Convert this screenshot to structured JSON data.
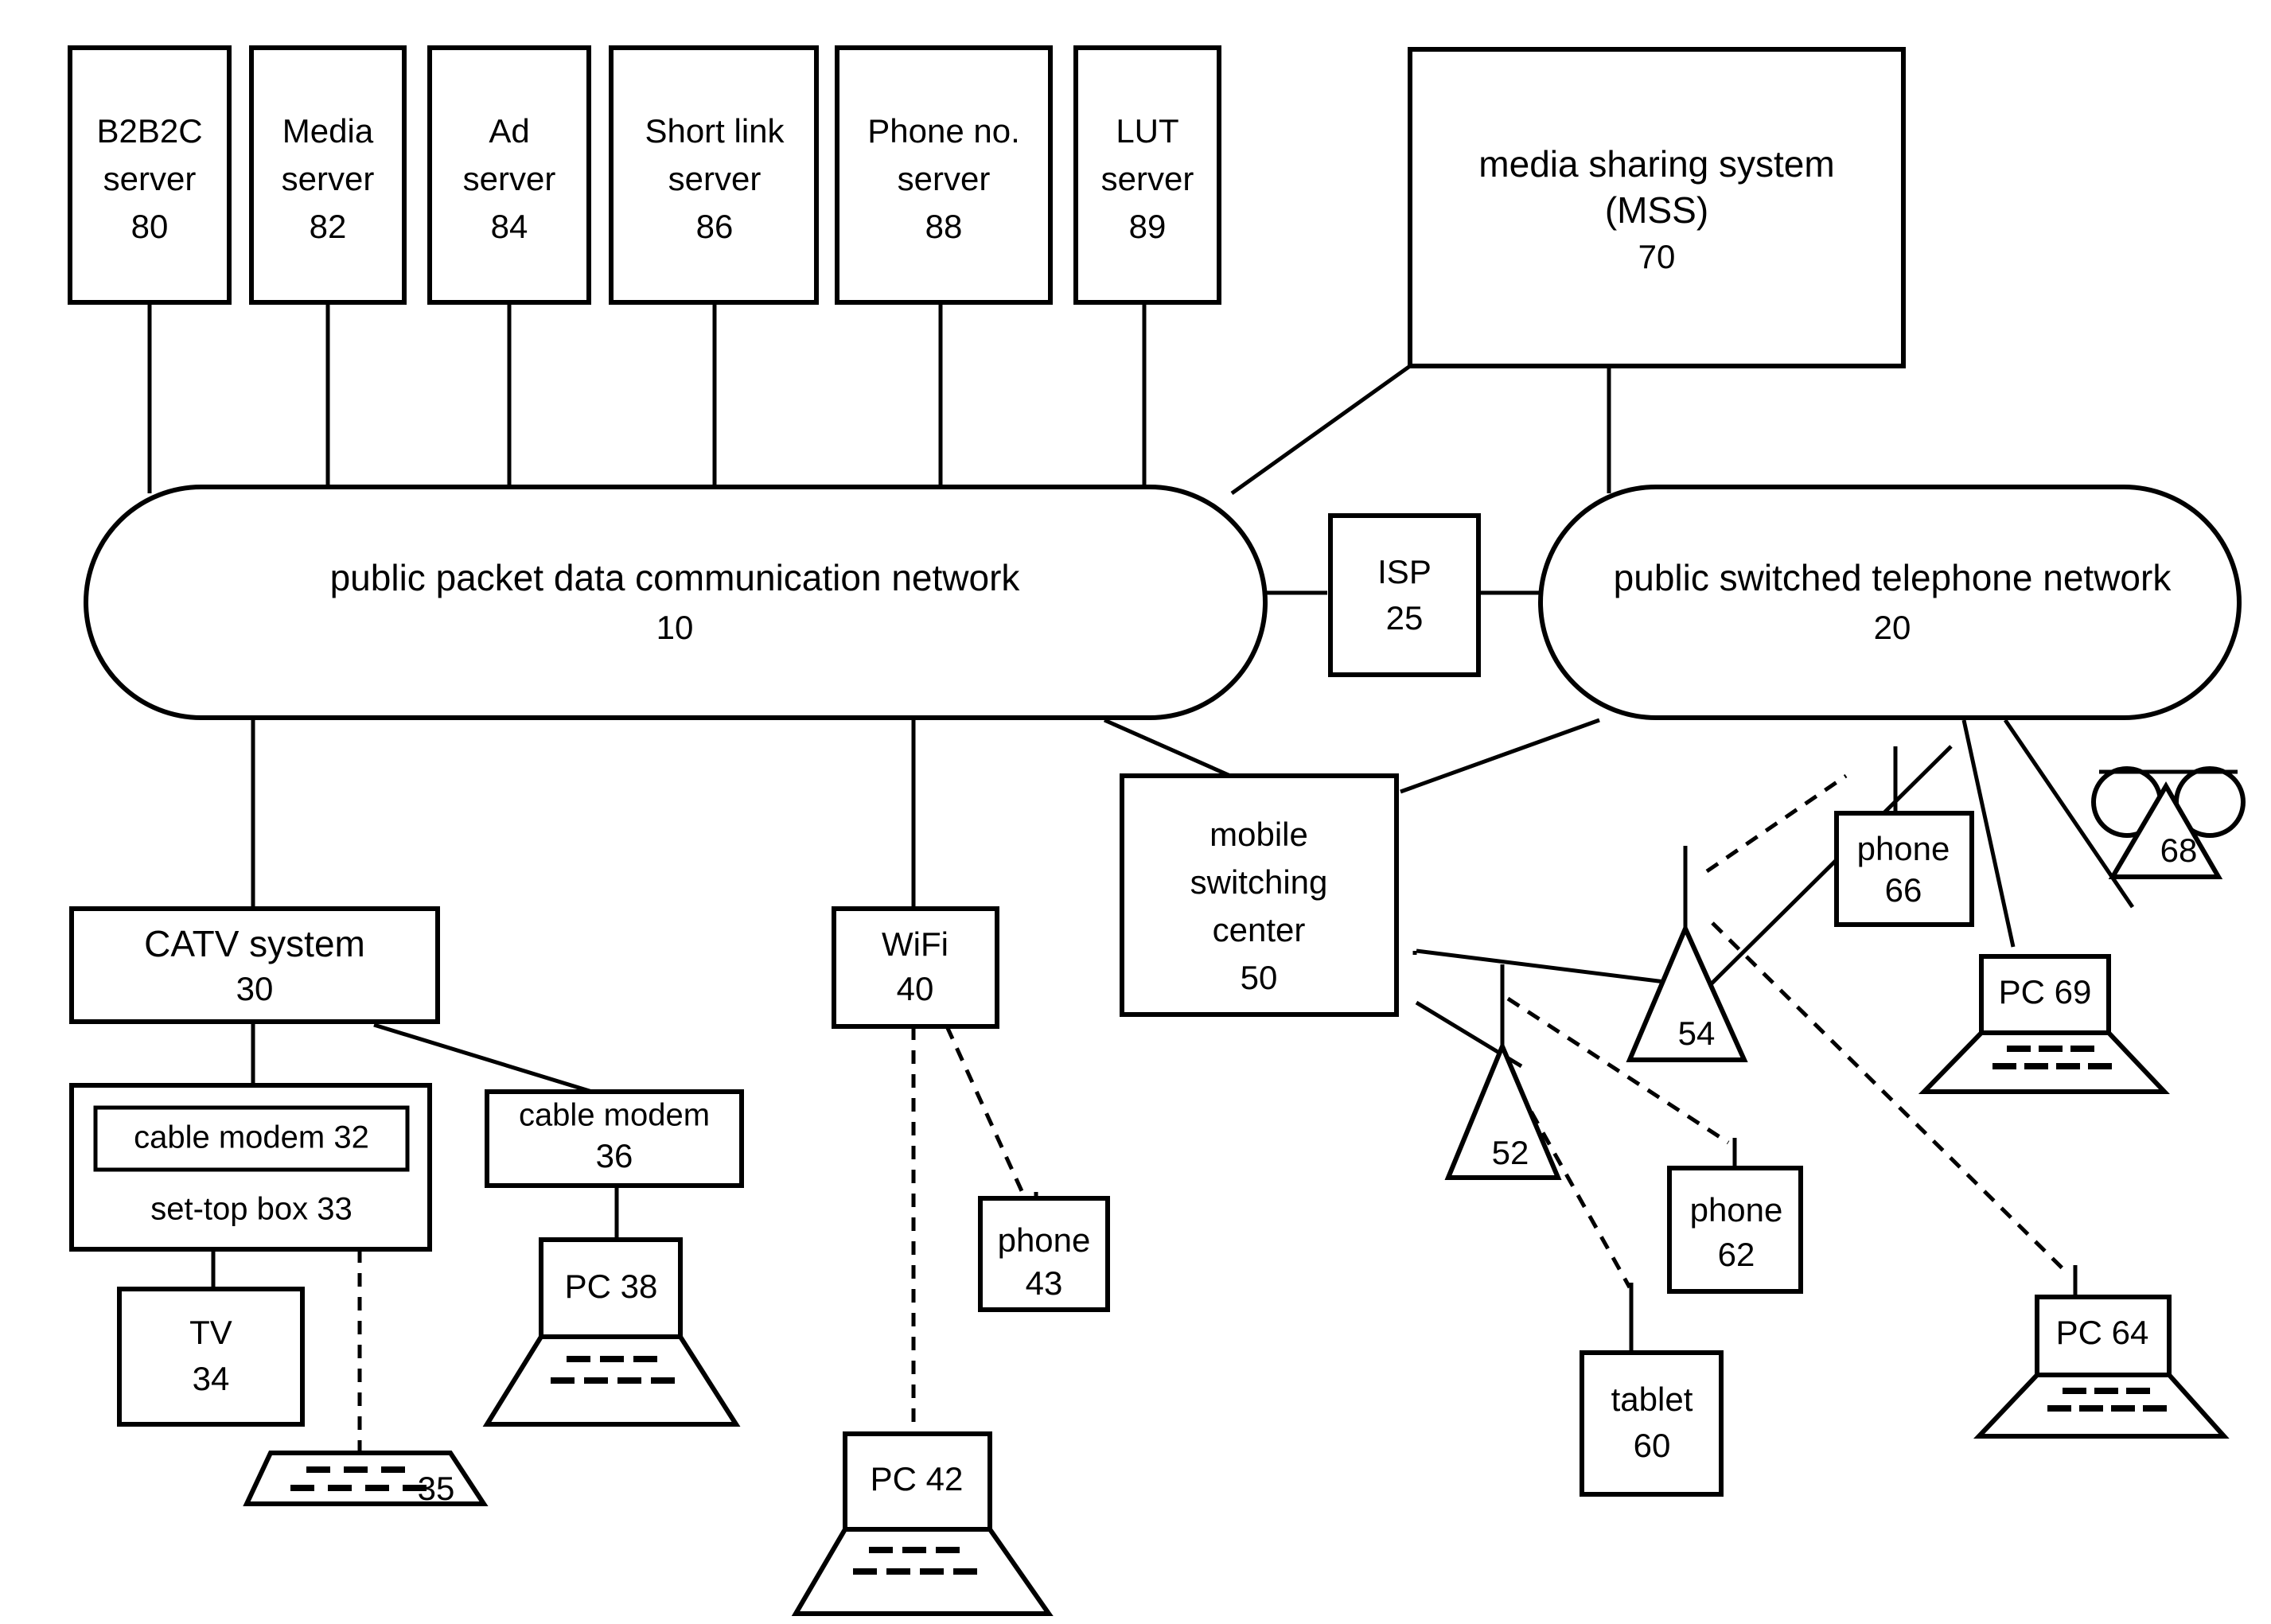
{
  "diagram": {
    "title": "network architecture block diagram",
    "servers": [
      {
        "id": "srv-b2b2c",
        "line1": "B2B2C",
        "line2": "server",
        "num": "80"
      },
      {
        "id": "srv-media",
        "line1": "Media",
        "line2": "server",
        "num": "82"
      },
      {
        "id": "srv-ad",
        "line1": "Ad",
        "line2": "server",
        "num": "84"
      },
      {
        "id": "srv-shortlink",
        "line1": "Short link",
        "line2": "server",
        "num": "86"
      },
      {
        "id": "srv-phoneno",
        "line1": "Phone no.",
        "line2": "server",
        "num": "88"
      },
      {
        "id": "srv-lut",
        "line1": "LUT",
        "line2": "server",
        "num": "89"
      }
    ],
    "mss": {
      "line1": "media sharing system",
      "line2": "(MSS)",
      "num": "70"
    },
    "ppdcn": {
      "label": "public packet data communication network",
      "num": "10"
    },
    "pstn": {
      "label": "public switched telephone network",
      "num": "20"
    },
    "isp": {
      "label": "ISP",
      "num": "25"
    },
    "catv": {
      "label": "CATV system",
      "num": "30"
    },
    "cable_modem_32": {
      "label": "cable modem 32"
    },
    "set_top_box_33": {
      "label": "set-top box 33"
    },
    "tv_34": {
      "line1": "TV",
      "num": "34"
    },
    "keyboard_35": {
      "num": "35"
    },
    "cable_modem_36": {
      "line1": "cable modem",
      "num": "36"
    },
    "pc_38": {
      "label": "PC 38"
    },
    "wifi_40": {
      "line1": "WiFi",
      "num": "40"
    },
    "pc_42": {
      "label": "PC 42"
    },
    "phone_43": {
      "line1": "phone",
      "num": "43"
    },
    "msc_50": {
      "line1": "mobile",
      "line2": "switching",
      "line3": "center",
      "num": "50"
    },
    "tower_52": {
      "num": "52"
    },
    "tower_54": {
      "num": "54"
    },
    "tablet_60": {
      "line1": "tablet",
      "num": "60"
    },
    "phone_62": {
      "line1": "phone",
      "num": "62"
    },
    "pc_64": {
      "label": "PC 64"
    },
    "phone_66": {
      "line1": "phone",
      "num": "66"
    },
    "antenna_68": {
      "num": "68"
    },
    "pc_69": {
      "label": "PC 69"
    }
  },
  "colors": {
    "stroke": "#000000",
    "fill": "#ffffff"
  }
}
